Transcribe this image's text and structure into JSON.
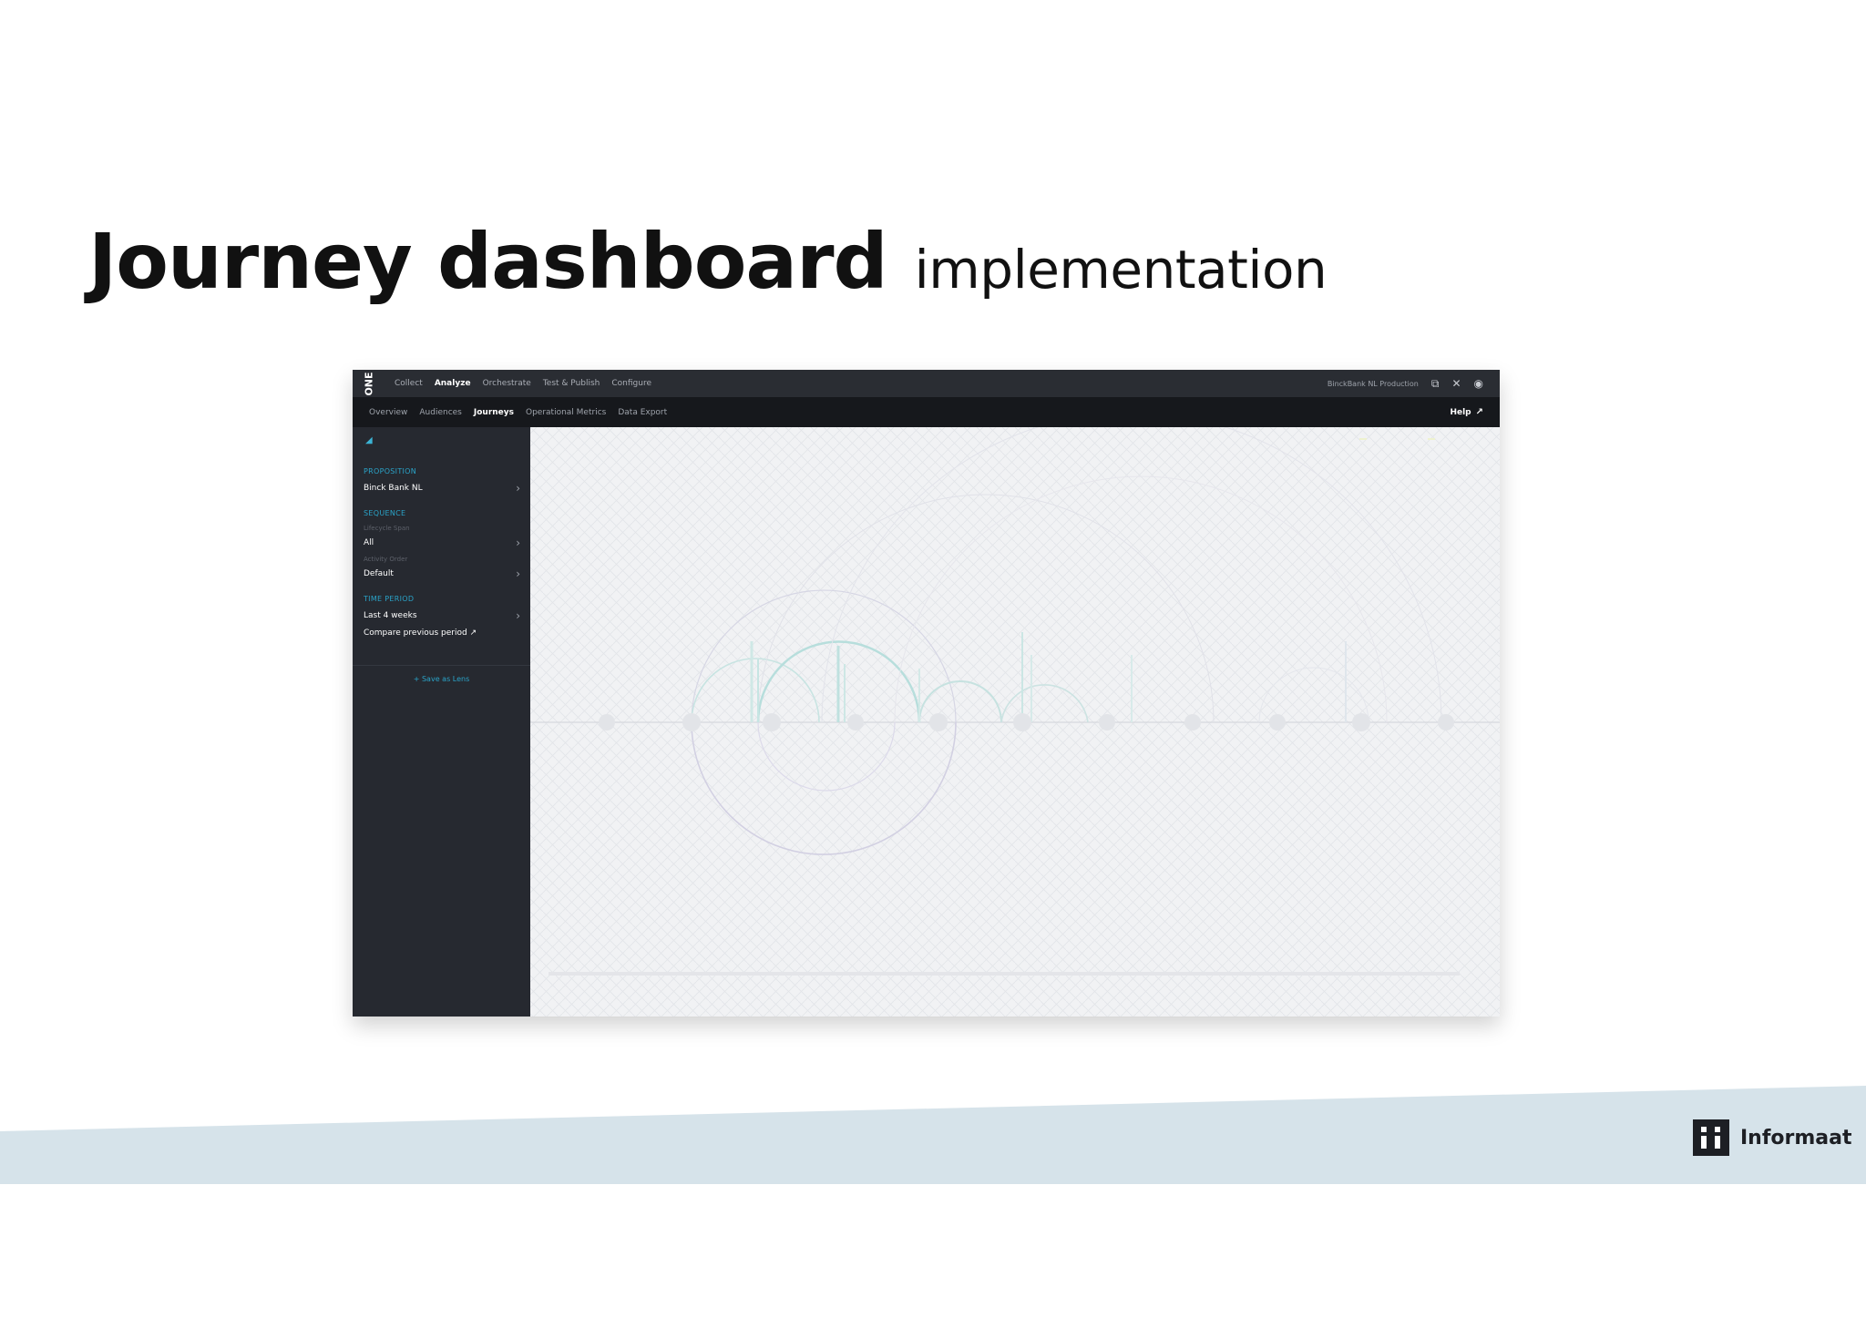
{
  "slide": {
    "title": "Journey dashboard",
    "subtitle": "implementation",
    "logo_name": "Informaat",
    "band_color": "#d6e3ea"
  },
  "app": {
    "brand": "ONE",
    "nav": [
      "Collect",
      "Analyze",
      "Orchestrate",
      "Test & Publish",
      "Configure"
    ],
    "active_nav": "Analyze",
    "environment": "BinckBank NL Production",
    "subnav": [
      "Overview",
      "Audiences",
      "Journeys",
      "Operational Metrics",
      "Data Export"
    ],
    "active_subnav": "Journeys",
    "help": "Help",
    "accent": "#2aa3c8"
  },
  "sidebar": {
    "proposition_heading": "PROPOSITION",
    "proposition_value": "Binck Bank NL",
    "sequence_heading": "SEQUENCE",
    "lifecycle_hint": "Lifecycle Span",
    "lifecycle_value": "All",
    "order_hint": "Activity Order",
    "order_value": "Default",
    "time_heading": "TIME PERIOD",
    "time_value": "Last 4 weeks",
    "compare_link": "Compare previous period",
    "save_lens": "+ Save as Lens"
  }
}
